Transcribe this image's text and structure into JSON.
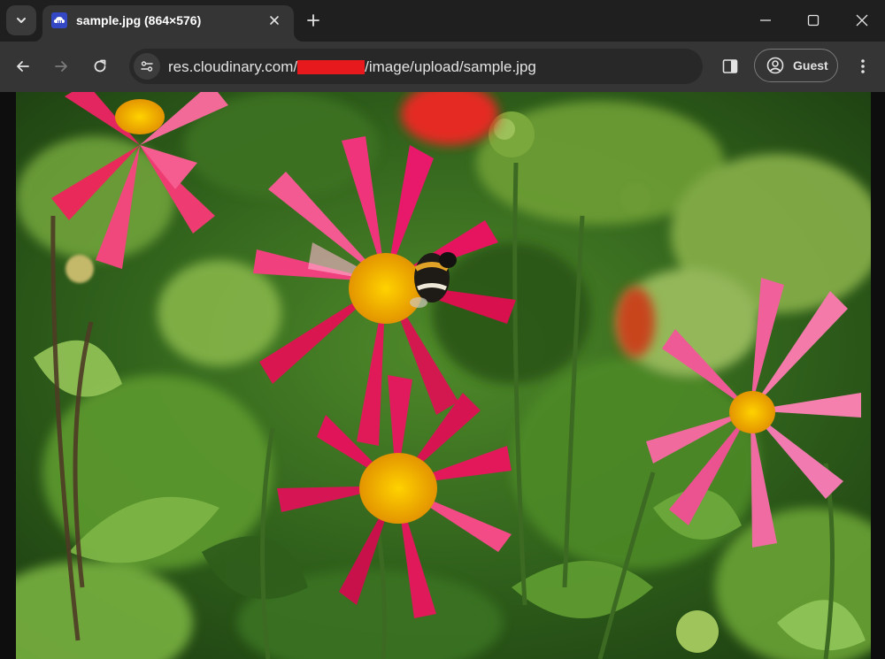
{
  "tab": {
    "title": "sample.jpg (864×576)",
    "favicon": "cloudinary-favicon-icon"
  },
  "url": {
    "prefix": "res.cloudinary.com/",
    "suffix": "/image/upload/sample.jpg"
  },
  "profile": {
    "label": "Guest"
  },
  "image": {
    "alt": "sample.jpg"
  },
  "colors": {
    "tabstrip": "#1f1f1f",
    "toolbar": "#353535",
    "omnibox": "#282828",
    "redaction": "#e8191c"
  }
}
